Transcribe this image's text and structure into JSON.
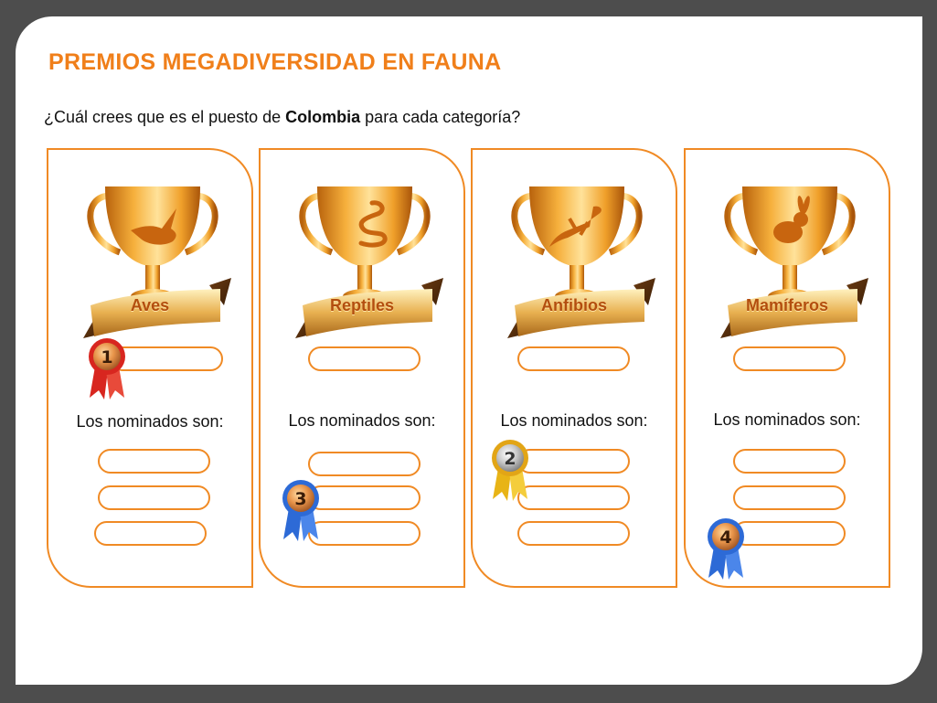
{
  "header": {
    "title": "PREMIOS MEGADIVERSIDAD EN FAUNA",
    "question_prefix": "¿Cuál crees que es el puesto de ",
    "question_bold": "Colombia",
    "question_suffix": " para cada categoría?"
  },
  "colors": {
    "accent": "#f07f1a",
    "border": "#f08a24",
    "frame": "#4d4d4d",
    "medal_red": "#d8261f",
    "medal_blue": "#2d6ad6",
    "medal_gold": "#e8b416"
  },
  "cards": [
    {
      "category": "Aves",
      "icon": "bird-icon",
      "nominados_label": "Los nominados son:"
    },
    {
      "category": "Reptiles",
      "icon": "snake-icon",
      "nominados_label": "Los nominados son:"
    },
    {
      "category": "Anfibios",
      "icon": "lizard-icon",
      "nominados_label": "Los nominados son:"
    },
    {
      "category": "Mamíferos",
      "icon": "rabbit-icon",
      "nominados_label": "Los nominados son:"
    }
  ],
  "medals": [
    {
      "number": "1",
      "ribbon": "red"
    },
    {
      "number": "2",
      "ribbon": "gold"
    },
    {
      "number": "3",
      "ribbon": "blue"
    },
    {
      "number": "4",
      "ribbon": "blue"
    }
  ]
}
